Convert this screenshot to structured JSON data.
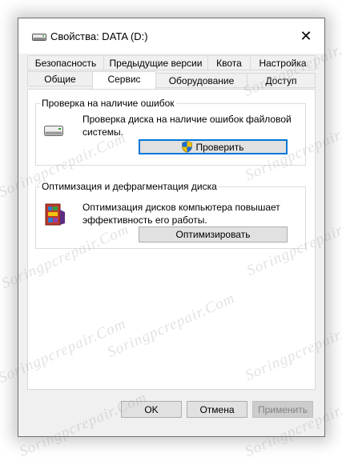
{
  "window": {
    "title": "Свойства: DATA (D:)",
    "close_glyph": "✕"
  },
  "tabs_row1": [
    {
      "label": "Безопасность"
    },
    {
      "label": "Предыдущие версии"
    },
    {
      "label": "Квота"
    },
    {
      "label": "Настройка"
    }
  ],
  "tabs_row2": [
    {
      "label": "Общие"
    },
    {
      "label": "Сервис",
      "active": true
    },
    {
      "label": "Оборудование"
    },
    {
      "label": "Доступ"
    }
  ],
  "error_check": {
    "title": "Проверка на наличие ошибок",
    "description": "Проверка диска на наличие ошибок файловой системы.",
    "button": "Проверить"
  },
  "optimize": {
    "title": "Оптимизация и дефрагментация диска",
    "description": "Оптимизация дисков компьютера повышает эффективность его работы.",
    "button": "Оптимизировать"
  },
  "footer": {
    "ok": "OK",
    "cancel": "Отмена",
    "apply": "Применить"
  },
  "watermark": "Soringpcrepair.Com",
  "colors": {
    "focus_blue": "#0078d7",
    "annotation_red": "#e53935"
  }
}
